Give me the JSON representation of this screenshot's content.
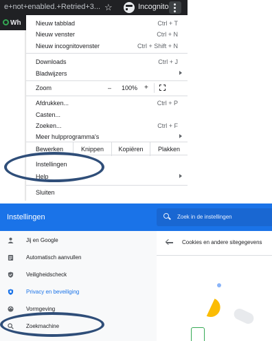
{
  "browser": {
    "url_fragment": "e+not+enabled.+Retried+3...",
    "incognito_label": "Incognito",
    "whatsapp_fragment": "Wh"
  },
  "menu": {
    "new_tab": {
      "label": "Nieuw tabblad",
      "shortcut": "Ctrl + T"
    },
    "new_window": {
      "label": "Nieuw venster",
      "shortcut": "Ctrl + N"
    },
    "new_incognito": {
      "label": "Nieuw incognitovenster",
      "shortcut": "Ctrl + Shift + N"
    },
    "downloads": {
      "label": "Downloads",
      "shortcut": "Ctrl + J"
    },
    "bookmarks": {
      "label": "Bladwijzers"
    },
    "zoom": {
      "label": "Zoom",
      "minus": "–",
      "value": "100%",
      "plus": "+"
    },
    "print": {
      "label": "Afdrukken...",
      "shortcut": "Ctrl + P"
    },
    "cast": {
      "label": "Casten..."
    },
    "find": {
      "label": "Zoeken...",
      "shortcut": "Ctrl + F"
    },
    "more_tools": {
      "label": "Meer hulpprogramma's"
    },
    "edit": {
      "label": "Bewerken",
      "cut": "Knippen",
      "copy": "Kopiëren",
      "paste": "Plakken"
    },
    "settings": {
      "label": "Instellingen"
    },
    "help": {
      "label": "Help"
    },
    "exit": {
      "label": "Sluiten"
    }
  },
  "settings": {
    "title": "Instellingen",
    "search_placeholder": "Zoek in de instellingen",
    "nav": [
      {
        "label": "Jij en Google",
        "icon": "person-icon"
      },
      {
        "label": "Automatisch aanvullen",
        "icon": "clipboard-icon"
      },
      {
        "label": "Veiligheidscheck",
        "icon": "shield-icon"
      },
      {
        "label": "Privacy en beveiliging",
        "icon": "shield-lock-icon"
      },
      {
        "label": "Vormgeving",
        "icon": "palette-icon"
      },
      {
        "label": "Zoekmachine",
        "icon": "search-icon"
      }
    ],
    "content_title": "Cookies en andere sitegegevens"
  },
  "colors": {
    "header_blue": "#1a73e8",
    "highlight_ellipse": "#2f4e79",
    "active_nav": "#1a73e8"
  }
}
